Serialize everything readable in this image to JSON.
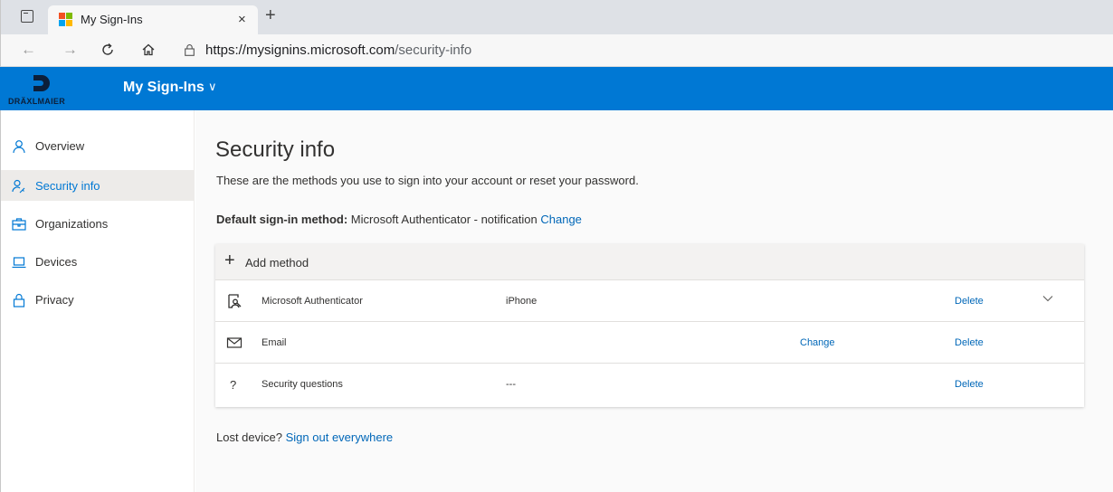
{
  "browser": {
    "tab_title": "My Sign-Ins",
    "tab_close": "×",
    "new_tab": "+",
    "url_host": "https://mysignins.microsoft.com",
    "url_path": "/security-info"
  },
  "header": {
    "brand": "DRÄXLMAIER",
    "title": "My Sign-Ins",
    "chevron": "∨",
    "color": "#0078d4"
  },
  "sidebar": {
    "items": [
      {
        "label": "Overview",
        "icon": "person-icon"
      },
      {
        "label": "Security info",
        "icon": "person-key-icon",
        "active": true
      },
      {
        "label": "Organizations",
        "icon": "briefcase-icon"
      },
      {
        "label": "Devices",
        "icon": "laptop-icon"
      },
      {
        "label": "Privacy",
        "icon": "lock-icon"
      }
    ]
  },
  "main": {
    "title": "Security info",
    "subtitle": "These are the methods you use to sign into your account or reset your password.",
    "default_label": "Default sign-in method:",
    "default_value": "Microsoft Authenticator - notification",
    "default_change": "Change",
    "add_method": "Add method",
    "methods": [
      {
        "icon": "authenticator-icon",
        "name": "Microsoft Authenticator",
        "detail": "iPhone",
        "change": "",
        "delete": "Delete",
        "expandable": true
      },
      {
        "icon": "mail-icon",
        "name": "Email",
        "detail": "",
        "change": "Change",
        "delete": "Delete"
      },
      {
        "icon": "question-icon",
        "name": "Security questions",
        "detail": "---",
        "change": "",
        "delete": "Delete"
      }
    ],
    "lost_device_text": "Lost device?",
    "lost_device_link": "Sign out everywhere"
  }
}
